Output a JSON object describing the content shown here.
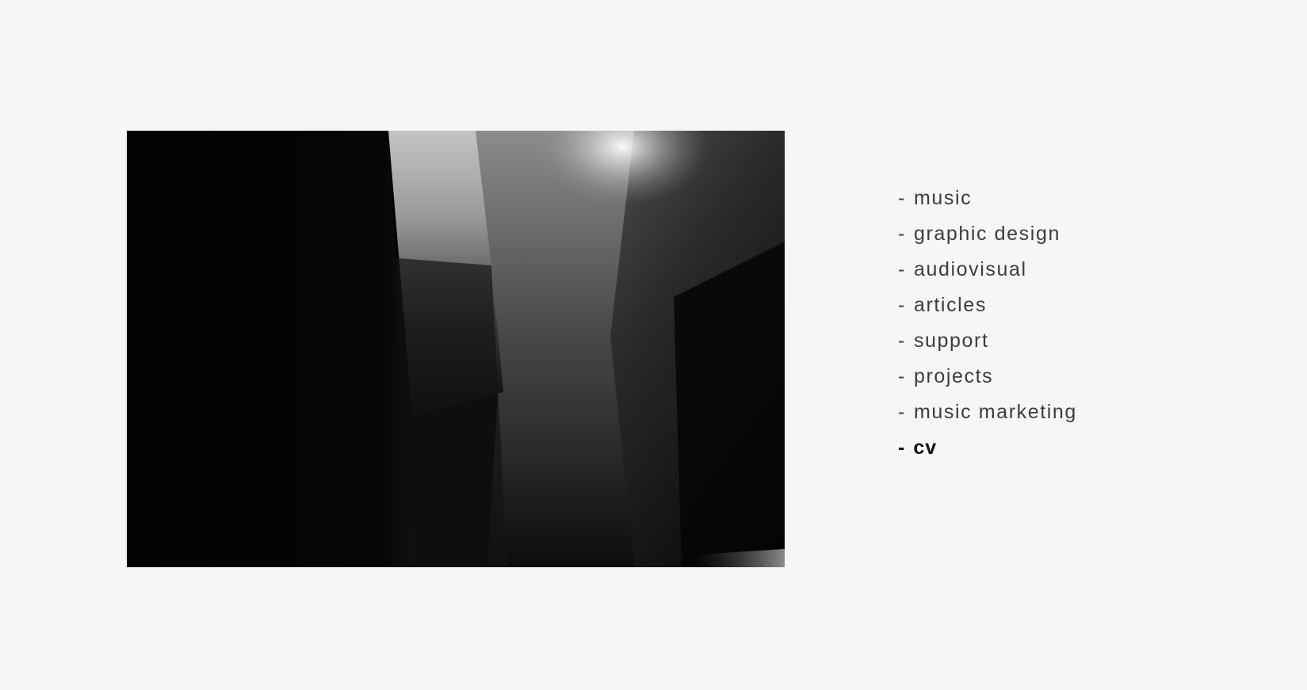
{
  "nav": {
    "items": [
      {
        "prefix": "-",
        "label": "music"
      },
      {
        "prefix": "-",
        "label": "graphic design"
      },
      {
        "prefix": "-",
        "label": "audiovisual"
      },
      {
        "prefix": "-",
        "label": "articles"
      },
      {
        "prefix": "-",
        "label": "support"
      },
      {
        "prefix": "-",
        "label": "projects"
      },
      {
        "prefix": "-",
        "label": "music marketing"
      },
      {
        "prefix": "-",
        "label": "cv"
      }
    ],
    "active_label": "cv"
  },
  "colors": {
    "background": "#f6f6f6",
    "text": "#3c3c3c",
    "active_text": "#141414"
  }
}
